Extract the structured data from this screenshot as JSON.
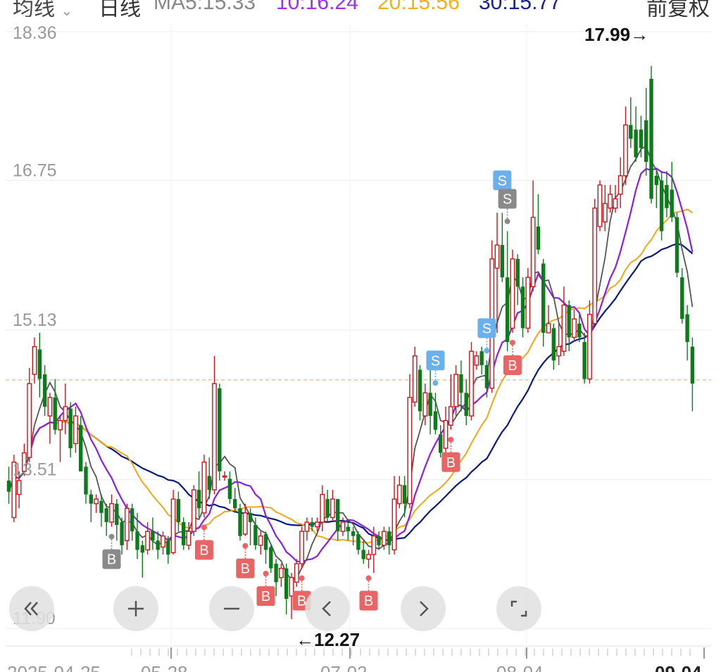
{
  "header": {
    "period_label": "均线",
    "chart_kind": "日线",
    "ma5": "MA5:15.33",
    "ma10": "10:16.24",
    "ma20": "20:15.56",
    "ma30": "30:15.77",
    "adjust": "前复权"
  },
  "controls": [
    "«",
    "+",
    "−",
    "‹",
    "›",
    "fullscreen"
  ],
  "colors": {
    "up": "#c8161d",
    "down": "#0d7a1c",
    "ma5": "#555555",
    "ma10": "#8b1fe0",
    "ma20": "#f0a818",
    "ma30": "#0a1a80",
    "buy": "#e86565",
    "sell": "#6ab0ee",
    "hold": "#8a8a8a"
  },
  "chart_data": {
    "type": "candlestick",
    "y_ticks": [
      "18.36",
      "16.75",
      "15.13",
      "13.51",
      "11.90"
    ],
    "ylim": [
      11.9,
      18.36
    ],
    "x_labels": [
      "2025-04-25",
      "05-28",
      "07-02",
      "08-04",
      "09-04"
    ],
    "last_price_line": 14.59,
    "max_label": "17.99→",
    "max_value": 17.99,
    "min_label": "←12.27",
    "min_value": 12.27,
    "ma_legend": {
      "MA5": 15.33,
      "MA10": 16.24,
      "MA20": 15.56,
      "MA30": 15.77
    },
    "candles": [
      [
        13.5,
        13.38,
        13.65,
        13.25
      ],
      [
        13.1,
        13.7,
        13.78,
        13.05
      ],
      [
        13.35,
        13.5,
        13.6,
        13.2
      ],
      [
        13.6,
        13.8,
        13.9,
        13.55
      ],
      [
        13.75,
        14.55,
        14.72,
        13.7
      ],
      [
        14.65,
        14.95,
        15.05,
        14.55
      ],
      [
        14.92,
        14.6,
        15.1,
        14.4
      ],
      [
        14.65,
        14.3,
        14.75,
        14.2
      ],
      [
        14.2,
        14.4,
        14.45,
        13.9
      ],
      [
        14.4,
        14.05,
        14.6,
        14.0
      ],
      [
        14.05,
        14.15,
        14.2,
        13.7
      ],
      [
        14.15,
        14.3,
        14.55,
        14.0
      ],
      [
        14.28,
        13.85,
        14.35,
        13.75
      ],
      [
        13.9,
        14.2,
        14.3,
        13.8
      ],
      [
        14.1,
        13.6,
        14.2,
        13.6
      ],
      [
        13.65,
        13.35,
        13.7,
        13.25
      ],
      [
        13.35,
        13.25,
        13.4,
        13.05
      ],
      [
        13.25,
        13.3,
        13.35,
        13.15
      ],
      [
        13.28,
        13.15,
        13.35,
        13.0
      ],
      [
        13.2,
        13.05,
        13.25,
        12.9
      ],
      [
        13.05,
        13.25,
        13.35,
        13.0
      ],
      [
        13.25,
        13.02,
        13.3,
        12.85
      ],
      [
        13.05,
        12.8,
        13.1,
        12.7
      ],
      [
        12.85,
        13.2,
        13.25,
        12.75
      ],
      [
        13.2,
        12.95,
        13.25,
        12.85
      ],
      [
        12.95,
        12.75,
        13.15,
        12.65
      ],
      [
        12.8,
        12.72,
        12.85,
        12.45
      ],
      [
        12.75,
        12.95,
        13.05,
        12.7
      ],
      [
        12.95,
        12.85,
        13.1,
        12.75
      ],
      [
        12.85,
        12.75,
        12.95,
        12.65
      ],
      [
        12.78,
        12.9,
        12.95,
        12.7
      ],
      [
        12.85,
        12.7,
        12.9,
        12.6
      ],
      [
        12.72,
        13.3,
        13.4,
        12.7
      ],
      [
        13.3,
        13.05,
        13.38,
        12.95
      ],
      [
        13.05,
        12.8,
        13.1,
        12.75
      ],
      [
        12.8,
        12.95,
        13.05,
        12.75
      ],
      [
        12.95,
        13.4,
        13.45,
        12.9
      ],
      [
        13.4,
        13.2,
        13.6,
        13.1
      ],
      [
        13.15,
        13.7,
        13.78,
        13.1
      ],
      [
        13.55,
        13.4,
        13.75,
        13.3
      ],
      [
        13.4,
        14.55,
        14.85,
        13.35
      ],
      [
        14.5,
        13.6,
        14.55,
        13.5
      ],
      [
        13.55,
        13.55,
        13.6,
        13.5
      ],
      [
        13.52,
        13.3,
        13.6,
        13.25
      ],
      [
        13.3,
        13.2,
        13.42,
        13.15
      ],
      [
        13.2,
        12.9,
        13.25,
        12.85
      ],
      [
        12.92,
        13.15,
        13.25,
        12.9
      ],
      [
        13.15,
        13.05,
        13.2,
        12.8
      ],
      [
        13.02,
        12.8,
        13.1,
        12.75
      ],
      [
        12.8,
        12.9,
        12.95,
        12.7
      ],
      [
        12.92,
        12.75,
        12.95,
        12.6
      ],
      [
        12.78,
        12.55,
        12.8,
        12.5
      ],
      [
        12.6,
        12.4,
        12.65,
        12.25
      ],
      [
        12.45,
        12.55,
        12.6,
        12.35
      ],
      [
        12.55,
        12.22,
        12.6,
        12.05
      ],
      [
        12.25,
        12.45,
        12.5,
        12.0
      ],
      [
        12.4,
        12.6,
        12.65,
        12.35
      ],
      [
        12.6,
        12.95,
        13.0,
        12.55
      ],
      [
        12.95,
        13.05,
        13.1,
        12.85
      ],
      [
        13.05,
        13.0,
        13.1,
        12.95
      ],
      [
        13.0,
        13.05,
        13.1,
        12.95
      ],
      [
        13.05,
        13.35,
        13.45,
        12.95
      ],
      [
        13.3,
        13.1,
        13.4,
        13.05
      ],
      [
        13.1,
        13.3,
        13.4,
        13.05
      ],
      [
        13.3,
        12.95,
        13.3,
        12.85
      ],
      [
        12.95,
        13.05,
        13.1,
        12.9
      ],
      [
        13.0,
        12.95,
        13.05,
        12.85
      ],
      [
        12.95,
        12.9,
        13.0,
        12.8
      ],
      [
        12.92,
        12.75,
        12.95,
        12.7
      ],
      [
        12.75,
        12.65,
        12.85,
        12.6
      ],
      [
        12.65,
        12.7,
        12.75,
        12.55
      ],
      [
        12.7,
        12.9,
        13.0,
        12.5
      ],
      [
        12.9,
        12.8,
        12.95,
        12.75
      ],
      [
        12.8,
        12.95,
        13.0,
        12.75
      ],
      [
        12.95,
        12.8,
        13.0,
        12.7
      ],
      [
        12.75,
        13.3,
        13.55,
        12.7
      ],
      [
        13.25,
        13.45,
        13.55,
        13.2
      ],
      [
        13.45,
        13.25,
        13.55,
        13.1
      ],
      [
        13.25,
        14.4,
        14.65,
        13.2
      ],
      [
        14.35,
        14.85,
        14.95,
        14.3
      ],
      [
        14.7,
        14.25,
        14.75,
        14.15
      ],
      [
        14.2,
        14.45,
        14.55,
        14.1
      ],
      [
        14.45,
        14.2,
        14.7,
        14.0
      ],
      [
        14.25,
        14.05,
        14.45,
        14.0
      ],
      [
        14.0,
        13.8,
        14.1,
        13.75
      ],
      [
        13.85,
        14.15,
        14.3,
        13.8
      ],
      [
        14.1,
        14.3,
        14.65,
        14.05
      ],
      [
        14.3,
        14.65,
        14.75,
        14.2
      ],
      [
        14.65,
        14.45,
        14.8,
        14.25
      ],
      [
        14.45,
        14.2,
        14.6,
        14.1
      ],
      [
        14.2,
        14.9,
        15.0,
        14.15
      ],
      [
        14.75,
        14.85,
        14.9,
        14.7
      ],
      [
        14.9,
        14.75,
        14.95,
        14.65
      ],
      [
        14.75,
        14.5,
        14.8,
        14.4
      ],
      [
        14.5,
        15.9,
        16.1,
        14.45
      ],
      [
        15.8,
        16.05,
        16.4,
        15.1
      ],
      [
        16.05,
        15.7,
        16.4,
        15.65
      ],
      [
        15.7,
        15.0,
        16.2,
        14.9
      ],
      [
        15.15,
        15.9,
        16.0,
        15.1
      ],
      [
        15.9,
        15.6,
        15.95,
        15.4
      ],
      [
        15.6,
        15.15,
        15.7,
        15.05
      ],
      [
        15.15,
        15.7,
        15.8,
        15.1
      ],
      [
        15.6,
        16.35,
        16.75,
        15.55
      ],
      [
        16.25,
        16.0,
        16.6,
        15.95
      ],
      [
        15.85,
        15.1,
        15.9,
        14.95
      ],
      [
        15.1,
        15.2,
        15.4,
        15.1
      ],
      [
        15.15,
        14.8,
        15.2,
        14.7
      ],
      [
        14.85,
        14.95,
        15.2,
        14.75
      ],
      [
        14.9,
        15.4,
        15.6,
        14.85
      ],
      [
        15.4,
        15.05,
        15.45,
        14.9
      ],
      [
        15.05,
        15.25,
        15.35,
        15.0
      ],
      [
        15.2,
        15.05,
        15.3,
        15.0
      ],
      [
        15.0,
        14.6,
        15.1,
        14.55
      ],
      [
        14.6,
        15.3,
        15.45,
        14.55
      ],
      [
        15.2,
        16.45,
        16.55,
        15.2
      ],
      [
        16.25,
        16.7,
        16.75,
        16.2
      ],
      [
        16.3,
        16.5,
        16.7,
        16.2
      ],
      [
        16.45,
        16.6,
        16.7,
        16.4
      ],
      [
        16.45,
        16.55,
        16.7,
        16.4
      ],
      [
        16.6,
        16.8,
        17.0,
        16.45
      ],
      [
        16.8,
        17.35,
        17.55,
        16.7
      ],
      [
        17.35,
        17.2,
        17.65,
        17.1
      ],
      [
        17.3,
        17.0,
        17.55,
        16.95
      ],
      [
        17.3,
        17.1,
        17.45,
        17.0
      ],
      [
        17.4,
        16.95,
        17.75,
        16.8
      ],
      [
        17.85,
        16.55,
        17.99,
        16.5
      ],
      [
        16.8,
        16.7,
        16.85,
        16.45
      ],
      [
        16.75,
        16.2,
        16.85,
        16.1
      ],
      [
        16.7,
        16.45,
        16.85,
        16.35
      ],
      [
        16.65,
        16.35,
        16.95,
        16.3
      ],
      [
        16.35,
        15.75,
        16.4,
        15.7
      ],
      [
        15.7,
        15.25,
        15.8,
        15.2
      ],
      [
        15.3,
        15.0,
        15.4,
        14.8
      ],
      [
        14.95,
        14.55,
        15.05,
        14.25
      ]
    ],
    "signals": [
      {
        "type": "B",
        "index": 20,
        "kind": "hold"
      },
      {
        "type": "B",
        "index": 38,
        "kind": "buy"
      },
      {
        "type": "B",
        "index": 46,
        "kind": "buy"
      },
      {
        "type": "B",
        "index": 50,
        "kind": "buy"
      },
      {
        "type": "B",
        "index": 57,
        "kind": "buy"
      },
      {
        "type": "B",
        "index": 70,
        "kind": "buy"
      },
      {
        "type": "S",
        "index": 83,
        "kind": "sell"
      },
      {
        "type": "B",
        "index": 86,
        "kind": "buy"
      },
      {
        "type": "S",
        "index": 93,
        "kind": "sell"
      },
      {
        "type": "S",
        "index": 96,
        "kind": "sell"
      },
      {
        "type": "S",
        "index": 97,
        "kind": "hold"
      },
      {
        "type": "B",
        "index": 98,
        "kind": "buy"
      }
    ]
  }
}
